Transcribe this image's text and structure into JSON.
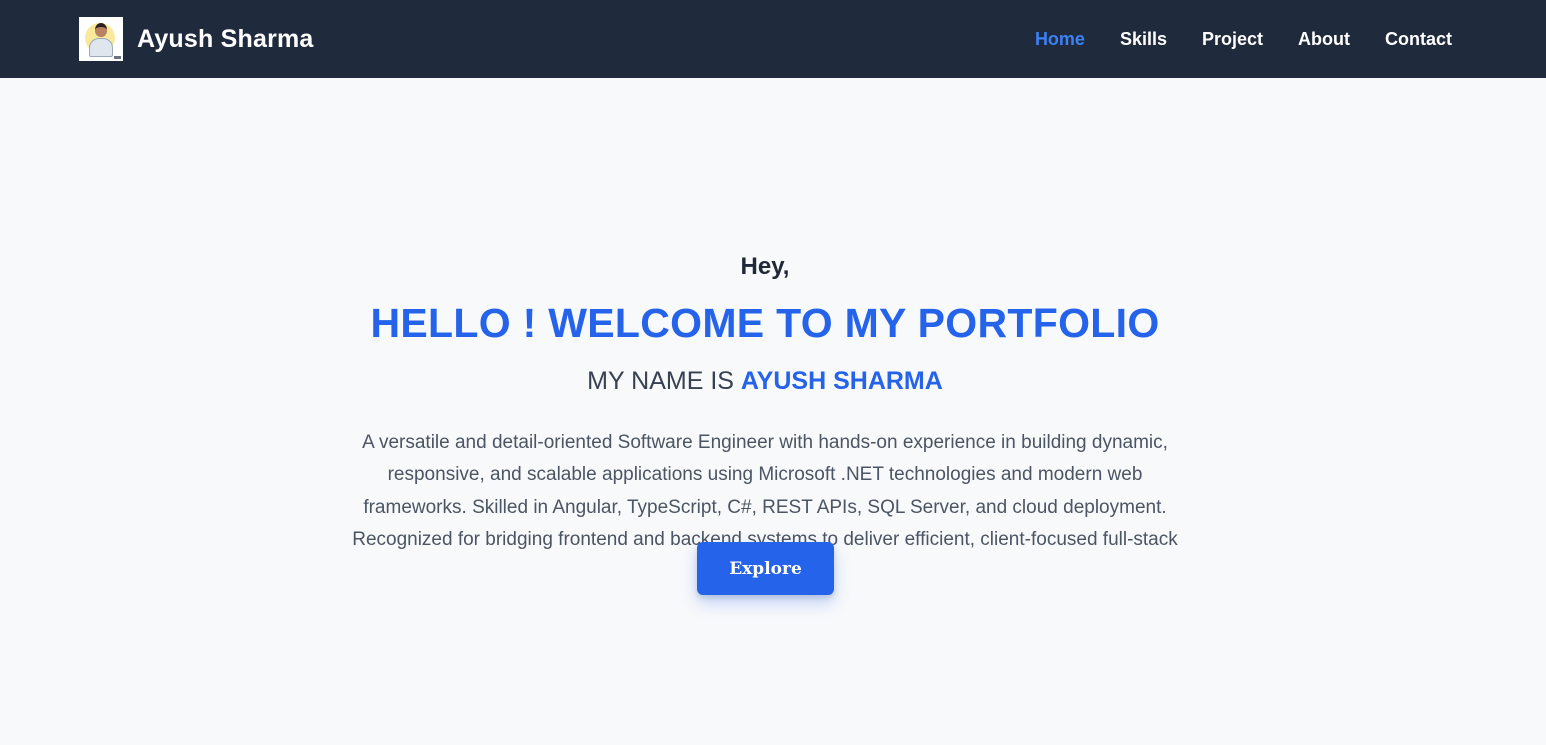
{
  "header": {
    "brand_name": "Ayush Sharma",
    "nav": [
      {
        "label": "Home",
        "active": true
      },
      {
        "label": "Skills",
        "active": false
      },
      {
        "label": "Project",
        "active": false
      },
      {
        "label": "About",
        "active": false
      },
      {
        "label": "Contact",
        "active": false
      }
    ]
  },
  "hero": {
    "greeting": "Hey,",
    "headline": "HELLO ! WELCOME TO MY PORTFOLIO",
    "name_prefix": "MY NAME IS ",
    "name_highlight": "AYUSH SHARMA",
    "bio": "A versatile and detail-oriented Software Engineer with hands-on experience in building dynamic, responsive, and scalable applications using Microsoft .NET technologies and modern web frameworks. Skilled in Angular, TypeScript, C#, REST APIs, SQL Server, and cloud deployment. Recognized for bridging frontend and backend systems to deliver efficient, client-focused full-stack solutions.",
    "cta_label": "Explore"
  },
  "colors": {
    "navbar_bg": "#1f2a3c",
    "accent": "#2563eb",
    "active_link": "#3b82f6",
    "page_bg": "#f8f9fb"
  }
}
